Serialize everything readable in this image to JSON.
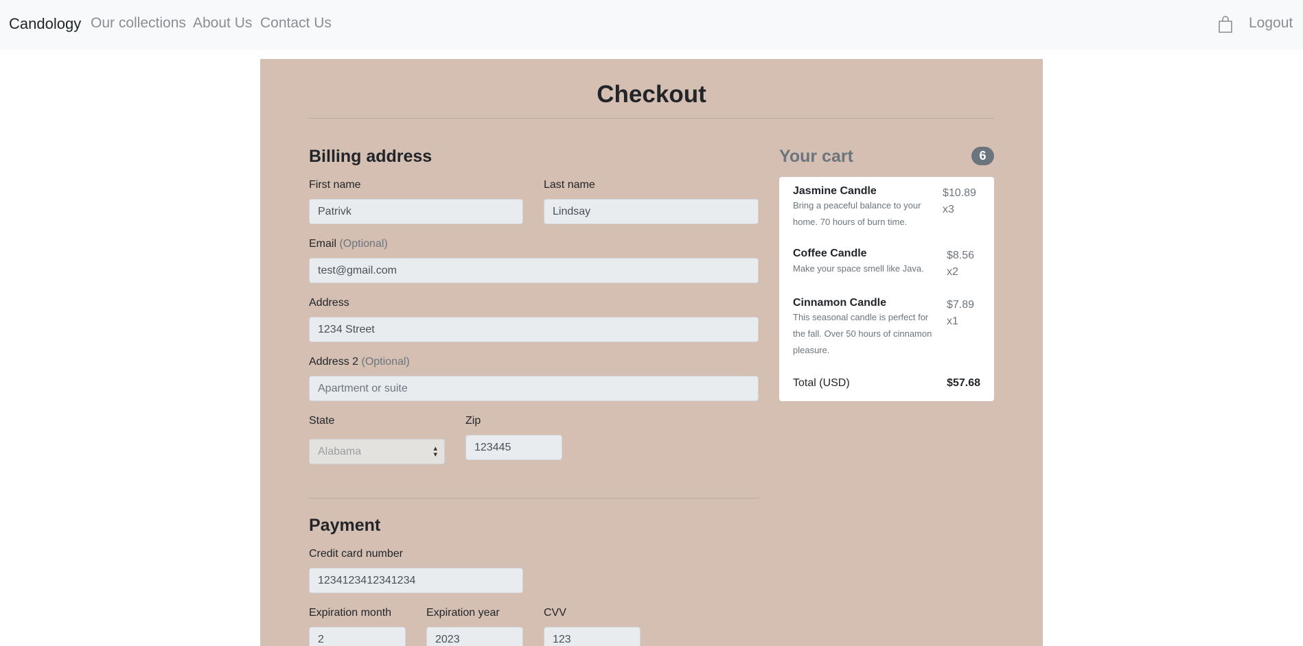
{
  "nav": {
    "brand": "Candology",
    "links": [
      "Our collections",
      "About Us",
      "Contact Us"
    ],
    "cart_icon": "shopping-bag-icon",
    "logout": "Logout"
  },
  "checkout": {
    "title": "Checkout",
    "billing": {
      "heading": "Billing address",
      "first_name_label": "First name",
      "first_name_value": "Patrivk",
      "last_name_label": "Last name",
      "last_name_value": "Lindsay",
      "email_label": "Email",
      "email_optional": "(Optional)",
      "email_value": "test@gmail.com",
      "address_label": "Address",
      "address_value": "1234 Street",
      "address2_label": "Address 2",
      "address2_optional": "(Optional)",
      "address2_placeholder": "Apartment or suite",
      "state_label": "State",
      "state_value": "Alabama",
      "zip_label": "Zip",
      "zip_value": "123445"
    },
    "payment": {
      "heading": "Payment",
      "card_label": "Credit card number",
      "card_value": "1234123412341234",
      "exp_month_label": "Expiration month",
      "exp_month_value": "2",
      "exp_year_label": "Expiration year",
      "exp_year_value": "2023",
      "cvv_label": "CVV",
      "cvv_value": "123"
    }
  },
  "cart": {
    "title": "Your cart",
    "count": "6",
    "items": [
      {
        "name": "Jasmine Candle",
        "desc": "Bring a peaceful balance to your home. 70 hours of burn time.",
        "price": "$10.89",
        "qty": "x3"
      },
      {
        "name": "Coffee Candle",
        "desc": "Make your space smell like Java.",
        "price": "$8.56",
        "qty": "x2"
      },
      {
        "name": "Cinnamon Candle",
        "desc": "This seasonal candle is perfect for the fall. Over 50 hours of cinnamon pleasure.",
        "price": "$7.89",
        "qty": "x1"
      }
    ],
    "total_label": "Total (USD)",
    "total_value": "$57.68"
  },
  "colors": {
    "panel_bg": "#d4bfb2",
    "nav_bg": "#f8f9fa",
    "badge_bg": "#6c757d"
  }
}
